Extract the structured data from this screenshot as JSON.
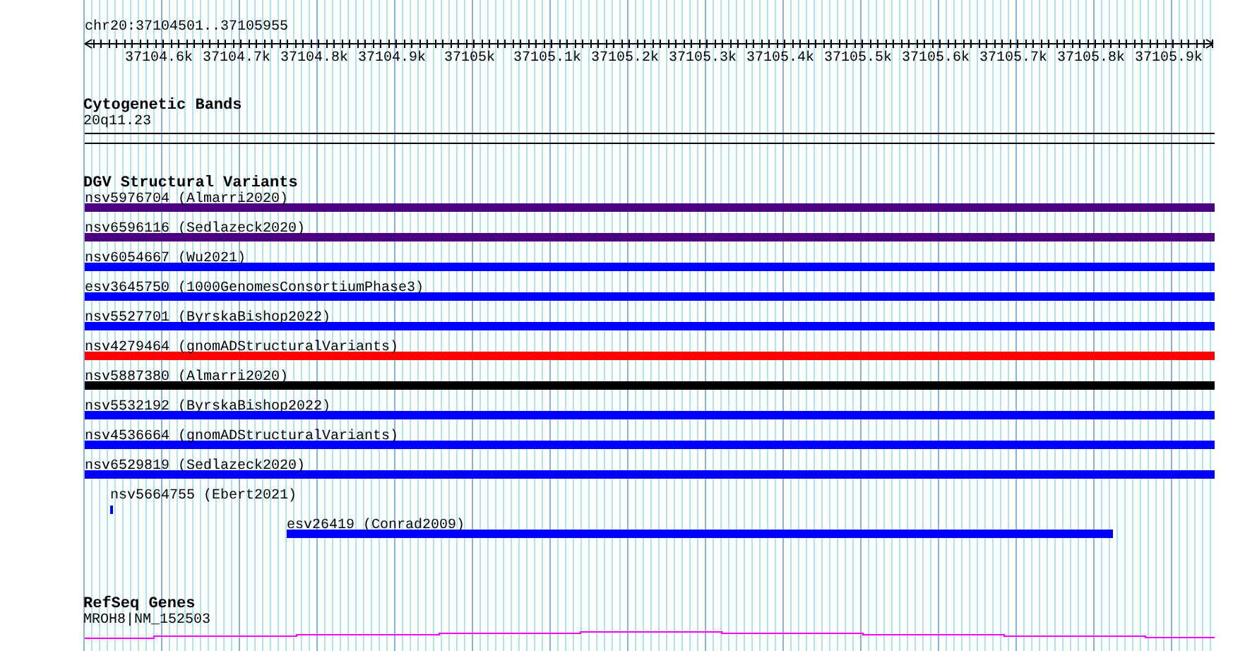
{
  "location": "chr20:37104501..37105955",
  "ruler": {
    "labels": [
      "37104.6k",
      "37104.7k",
      "37104.8k",
      "37104.9k",
      "37105k",
      "37105.1k",
      "37105.2k",
      "37105.3k",
      "37105.4k",
      "37105.5k",
      "37105.6k",
      "37105.7k",
      "37105.8k",
      "37105.9k"
    ]
  },
  "tracks": [
    {
      "kind": "bands",
      "title": "Cytogenetic Bands",
      "features": [
        {
          "label": "20q11.23"
        }
      ]
    },
    {
      "kind": "variants",
      "title": "DGV Structural Variants",
      "features": [
        {
          "label": "nsv5976704 (Almarri2020)",
          "color": "#4b0082"
        },
        {
          "label": "nsv6596116 (Sedlazeck2020)",
          "color": "#4b0082"
        },
        {
          "label": "nsv6054667 (Wu2021)",
          "color": "#0000ff"
        },
        {
          "label": "esv3645750 (1000GenomesConsortiumPhase3)",
          "color": "#0000ff"
        },
        {
          "label": "nsv5527701 (ByrskaBishop2022)",
          "color": "#0000ff"
        },
        {
          "label": "nsv4279464 (gnomADStructuralVariants)",
          "color": "#ff0000"
        },
        {
          "label": "nsv5887380 (Almarri2020)",
          "color": "#000000"
        },
        {
          "label": "nsv5532192 (ByrskaBishop2022)",
          "color": "#0000ff"
        },
        {
          "label": "nsv4536664 (gnomADStructuralVariants)",
          "color": "#0000ff"
        },
        {
          "label": "nsv6529819 (Sedlazeck2020)",
          "color": "#0000ff"
        },
        {
          "label": "nsv5664755 (Ebert2021)",
          "color": "#0000ff"
        },
        {
          "label": "esv26419 (Conrad2009)",
          "color": "#0000ff"
        }
      ]
    },
    {
      "kind": "genes",
      "title": "RefSeq Genes",
      "features": [
        {
          "label": "MROH8|NM_152503"
        }
      ]
    }
  ]
}
